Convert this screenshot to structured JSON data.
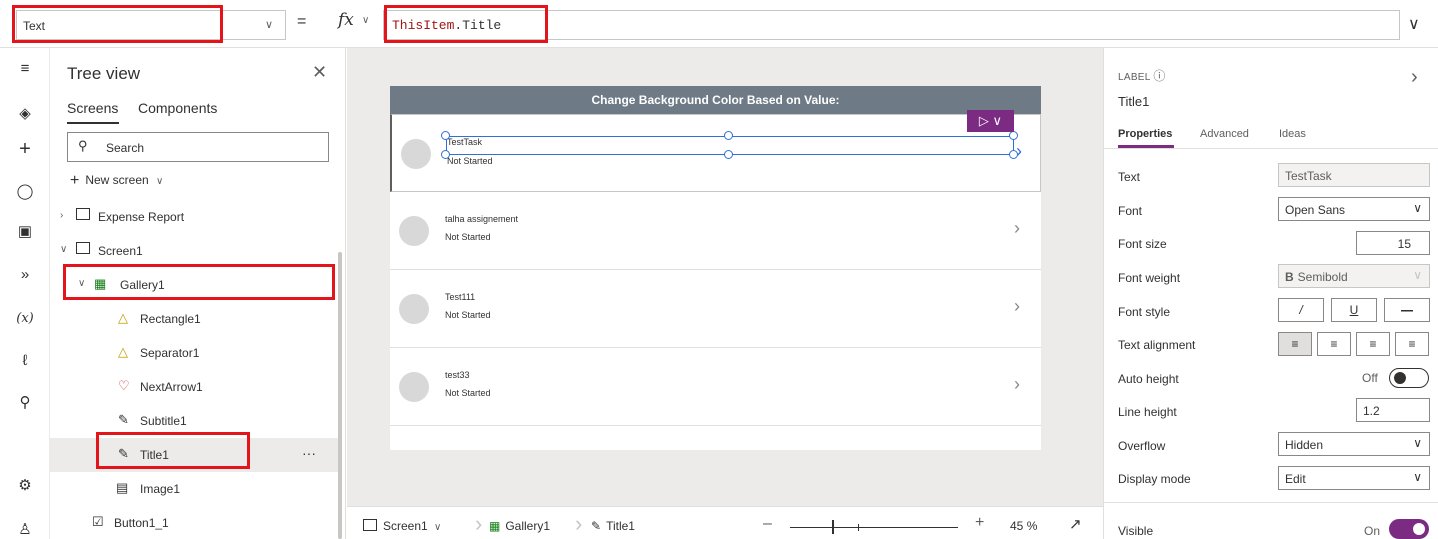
{
  "formula_bar": {
    "property": "Text",
    "equals": "=",
    "fx_label": "fx",
    "formula_keyword": "ThisItem",
    "formula_rest": ".Title"
  },
  "tree": {
    "title": "Tree view",
    "tabs": [
      "Screens",
      "Components"
    ],
    "search_placeholder": "Search",
    "new_screen": "New screen",
    "nodes": {
      "expense_report": "Expense Report",
      "screen1": "Screen1",
      "gallery1": "Gallery1",
      "rectangle1": "Rectangle1",
      "separator1": "Separator1",
      "nextarrow1": "NextArrow1",
      "subtitle1": "Subtitle1",
      "title1": "Title1",
      "image1": "Image1",
      "button1_1": "Button1_1"
    },
    "more": "···"
  },
  "app": {
    "header": "Change Background Color Based on Value:",
    "items": [
      {
        "title": "TestTask",
        "subtitle": "Not Started"
      },
      {
        "title": "talha assignement",
        "subtitle": "Not Started"
      },
      {
        "title": "Test111",
        "subtitle": "Not Started"
      },
      {
        "title": "test33",
        "subtitle": "Not Started"
      }
    ]
  },
  "status": {
    "screen": "Screen1",
    "gallery": "Gallery1",
    "control": "Title1",
    "zoom": "45",
    "zoom_unit": "%"
  },
  "panel": {
    "type_label": "LABEL",
    "control_name": "Title1",
    "tabs": [
      "Properties",
      "Advanced",
      "Ideas"
    ],
    "rows": {
      "text_label": "Text",
      "text_value": "TestTask",
      "font_label": "Font",
      "font_value": "Open Sans",
      "font_size_label": "Font size",
      "font_size_value": "15",
      "font_weight_label": "Font weight",
      "font_weight_value": "Semibold",
      "font_weight_glyph": "B",
      "font_style_label": "Font style",
      "text_alignment_label": "Text alignment",
      "auto_height_label": "Auto height",
      "auto_height_value": "Off",
      "line_height_label": "Line height",
      "line_height_value": "1.2",
      "overflow_label": "Overflow",
      "overflow_value": "Hidden",
      "display_mode_label": "Display mode",
      "display_mode_value": "Edit",
      "visible_label": "Visible",
      "visible_value": "On"
    },
    "font_style_buttons": [
      "/",
      "U",
      "—"
    ]
  },
  "colors": {
    "accent": "#7b2b82",
    "highlight": "#e3151a",
    "selection": "#2f6fdb",
    "header": "#6e7a86"
  }
}
